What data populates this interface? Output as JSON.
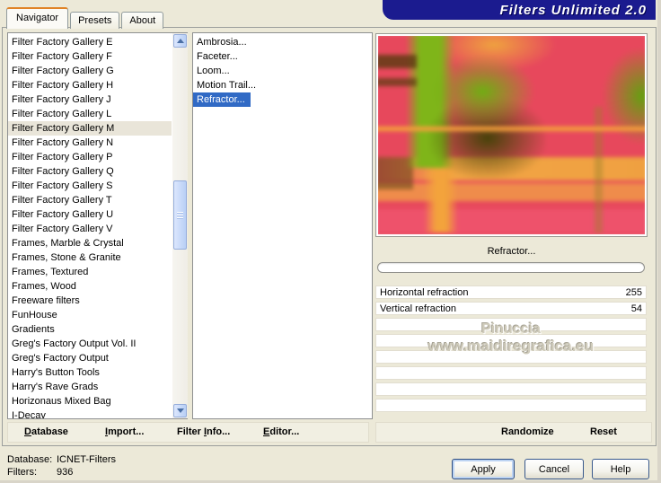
{
  "window": {
    "title": "Filters Unlimited 2.0"
  },
  "tabs": [
    {
      "label": "Navigator",
      "selected": true
    },
    {
      "label": "Presets"
    },
    {
      "label": "About"
    }
  ],
  "category_list": {
    "items": [
      {
        "label": "Filter Factory Gallery E"
      },
      {
        "label": "Filter Factory Gallery F"
      },
      {
        "label": "Filter Factory Gallery G"
      },
      {
        "label": "Filter Factory Gallery H"
      },
      {
        "label": "Filter Factory Gallery J"
      },
      {
        "label": "Filter Factory Gallery L"
      },
      {
        "label": "Filter Factory Gallery M",
        "selected": true
      },
      {
        "label": "Filter Factory Gallery N"
      },
      {
        "label": "Filter Factory Gallery P"
      },
      {
        "label": "Filter Factory Gallery Q"
      },
      {
        "label": "Filter Factory Gallery S"
      },
      {
        "label": "Filter Factory Gallery T"
      },
      {
        "label": "Filter Factory Gallery U"
      },
      {
        "label": "Filter Factory Gallery V"
      },
      {
        "label": "Frames, Marble & Crystal"
      },
      {
        "label": "Frames, Stone & Granite"
      },
      {
        "label": "Frames, Textured"
      },
      {
        "label": "Frames, Wood"
      },
      {
        "label": "Freeware filters"
      },
      {
        "label": "FunHouse"
      },
      {
        "label": "Gradients"
      },
      {
        "label": "Greg's Factory Output Vol. II"
      },
      {
        "label": "Greg's Factory Output"
      },
      {
        "label": "Harry's Button Tools"
      },
      {
        "label": "Harry's Rave Grads"
      },
      {
        "label": "Horizonaus Mixed Bag"
      },
      {
        "label": "I-Decay"
      }
    ]
  },
  "filter_list": {
    "items": [
      {
        "label": "Ambrosia..."
      },
      {
        "label": "Faceter..."
      },
      {
        "label": "Loom..."
      },
      {
        "label": "Motion Trail..."
      },
      {
        "label": "Refractor...",
        "selected": true
      }
    ]
  },
  "preview": {
    "filter_name": "Refractor..."
  },
  "parameters": [
    {
      "name": "Horizontal refraction",
      "value": "255"
    },
    {
      "name": "Vertical refraction",
      "value": "54"
    }
  ],
  "watermark": {
    "line1": "Pinuccia",
    "line2": "www.maidiregrafica.eu"
  },
  "toolbar": {
    "database": "Database",
    "import": "Import...",
    "filter_info": "Filter Info...",
    "editor": "Editor...",
    "randomize": "Randomize",
    "reset": "Reset"
  },
  "status": {
    "database_label": "Database:",
    "database_value": "ICNET-Filters",
    "filters_label": "Filters:",
    "filters_value": "936"
  },
  "buttons": {
    "apply": "Apply",
    "cancel": "Cancel",
    "help": "Help"
  },
  "colors": {
    "dialog_bg": "#ECE9D8",
    "banner": "#1B1B8F",
    "selection": "#316AC5",
    "preview_base": "#E7485C",
    "preview_green": "#7FB519",
    "preview_orange": "#F2A544",
    "preview_dark_olive": "#474209"
  }
}
